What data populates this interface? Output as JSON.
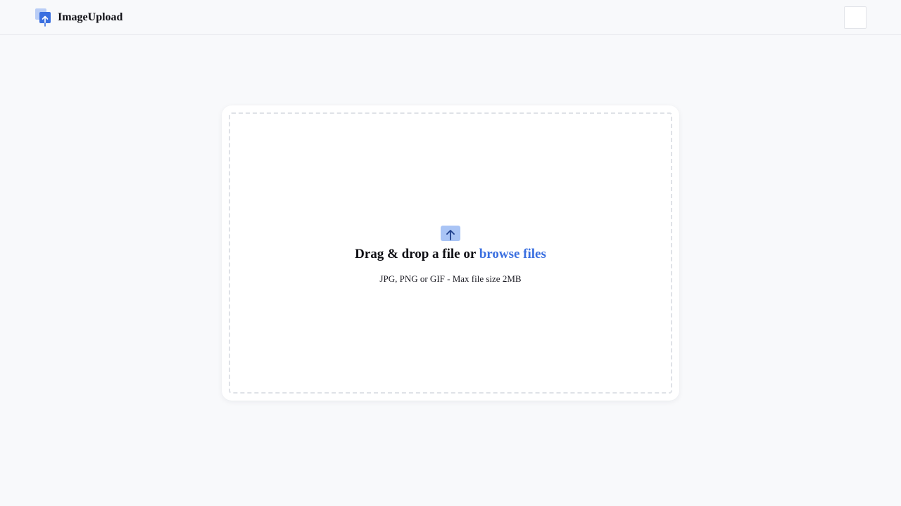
{
  "header": {
    "app_name": "ImageUpload",
    "logo_icon": "image-upload-logo-icon",
    "theme_toggle_icon": "moon-icon"
  },
  "uploader": {
    "icon": "upload-arrow-icon",
    "title_prefix": "Drag & drop a file or ",
    "browse_label": "browse files",
    "hint": "JPG, PNG or GIF - Max file size 2MB"
  },
  "colors": {
    "background": "#f8f9fb",
    "card": "#ffffff",
    "accent": "#3a6fe0",
    "accent_light": "#a9c4f5",
    "dashed_border": "#dfe2e7",
    "text": "#0f0f14"
  }
}
